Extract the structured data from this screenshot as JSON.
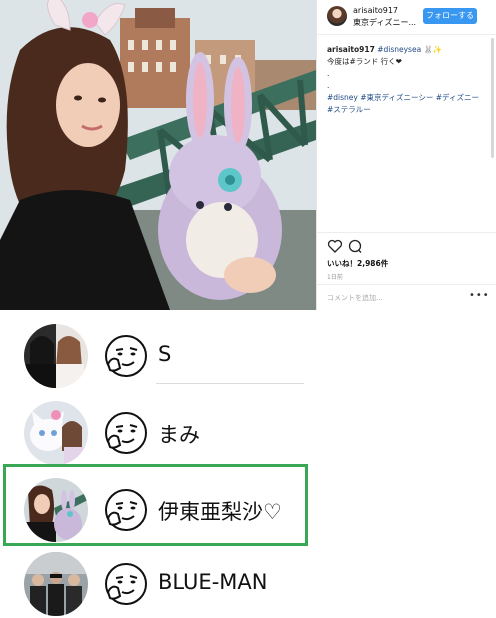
{
  "post": {
    "username": "arisaito917",
    "location": "東京ディズニー...",
    "follow_label": "フォローする",
    "caption_user": "arisaito917",
    "caption_tag_inline": "#disneysea 🐰✨",
    "caption_line2": "今度は#ランド 行く❤",
    "caption_dot1": ".",
    "caption_dot2": ".",
    "caption_tags1": "#disney #東京ディズニーシー #ディズニー",
    "caption_tags2": "#ステラルー",
    "likes": "いいね！2,986件",
    "date": "1日前",
    "comment_placeholder": "コメントを追加...",
    "more": "•••",
    "icons": {
      "like": "heart-icon",
      "comment": "comment-icon",
      "more": "more-icon"
    },
    "colors": {
      "follow": "#3897f0",
      "tags": "#1f4a86"
    }
  },
  "chat_list": {
    "rows": [
      {
        "name": "S",
        "avatar": "avatar-dark-couple"
      },
      {
        "name": "まみ",
        "avatar": "avatar-white-cat"
      },
      {
        "name": "伊東亜梨沙♡",
        "avatar": "avatar-woman-plush"
      },
      {
        "name": "BLUE-MAN",
        "avatar": "avatar-group-photo"
      }
    ],
    "sticker_icon": "smirk-face-sticker",
    "highlight_color": "#3aa757"
  }
}
